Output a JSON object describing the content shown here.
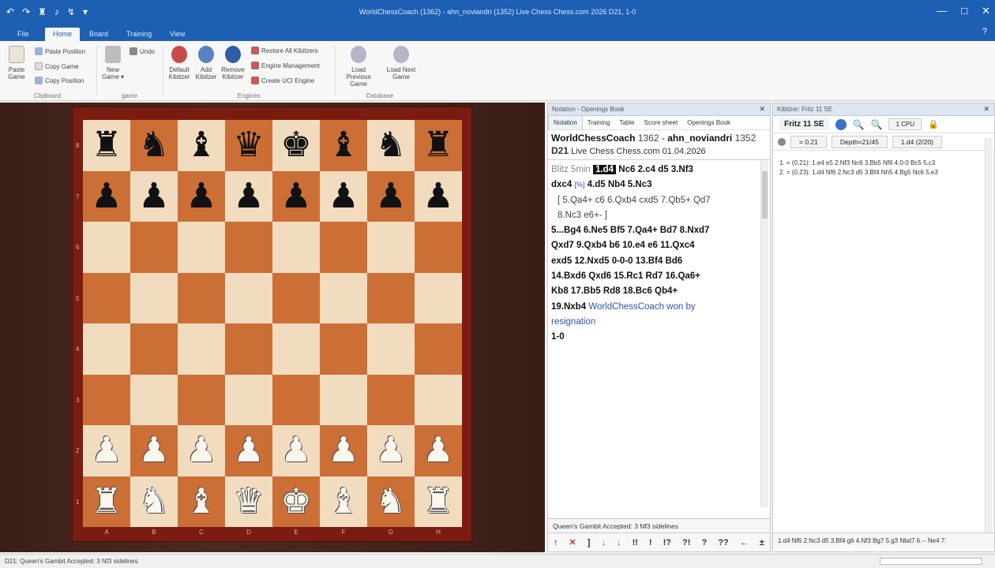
{
  "window": {
    "title": "WorldChessCoach (1362) - ahn_noviandri (1352) Live Chess Chess.com 2026  D21, 1-0",
    "controls": [
      "—",
      "□",
      "✕"
    ]
  },
  "quick_access": [
    "↶",
    "↷",
    "♜",
    "♪",
    "↯",
    "▾"
  ],
  "menu_tabs": [
    "File",
    "Home",
    "Board",
    "Training",
    "View"
  ],
  "active_tab": "Home",
  "help_icon": "?",
  "ribbon": {
    "clipboard": {
      "label": "Clipboard",
      "paste_game": "Paste Game",
      "paste_position": "Paste Position",
      "copy_game": "Copy Game",
      "copy_position": "Copy Position"
    },
    "game": {
      "label": "game",
      "new_game": "New Game ▾",
      "undo": "Undo"
    },
    "engines": {
      "label": "Engines",
      "default_kibitzer": "Default Kibitzer",
      "add_kibitzer": "Add Kibitzer",
      "remove_kibitzer": "Remove Kibitzer",
      "restore_all": "Restore All Kibitzers",
      "engine_management": "Engine Management",
      "create_uci": "Create UCI Engine"
    },
    "database": {
      "label": "Database",
      "load_previous": "Load Previous Game",
      "load_next": "Load Next Game"
    }
  },
  "board": {
    "ranks": [
      "8",
      "7",
      "6",
      "5",
      "4",
      "3",
      "2",
      "1"
    ],
    "files": [
      "A",
      "B",
      "C",
      "D",
      "E",
      "F",
      "G",
      "H"
    ],
    "position": [
      [
        "r",
        "n",
        "b",
        "q",
        "k",
        "b",
        "n",
        "r"
      ],
      [
        "p",
        "p",
        "p",
        "p",
        "p",
        "p",
        "p",
        "p"
      ],
      [
        "",
        "",
        "",
        "",
        "",
        "",
        "",
        ""
      ],
      [
        "",
        "",
        "",
        "",
        "",
        "",
        "",
        ""
      ],
      [
        "",
        "",
        "",
        "",
        "",
        "",
        "",
        ""
      ],
      [
        "",
        "",
        "",
        "",
        "",
        "",
        "",
        ""
      ],
      [
        "P",
        "P",
        "P",
        "P",
        "P",
        "P",
        "P",
        "P"
      ],
      [
        "R",
        "N",
        "B",
        "Q",
        "K",
        "B",
        "N",
        "R"
      ]
    ]
  },
  "notation": {
    "panel_title": "Notation - Openings Book",
    "close": "✕",
    "tabs": [
      "Notation",
      "Training",
      "Table",
      "Score sheet",
      "Openings Book"
    ],
    "white": "WorldChessCoach",
    "white_elo": "1362",
    "sep": "-",
    "black": "ahn_noviandri",
    "black_elo": "1352",
    "eco": "D21",
    "event": "Live Chess Chess.com 01.04.2026",
    "time_control": "Blitz 5min",
    "line1": [
      "1.d4",
      "Nc6",
      "2.c4",
      "d5",
      "3.Nf3"
    ],
    "line2": [
      "dxc4",
      "[%]",
      "4.d5",
      "Nb4",
      "5.Nc3"
    ],
    "variation1": "[ 5.Qa4+  c6  6.Qxb4  cxd5  7.Qb5+  Qd7",
    "variation2": "8.Nc3  e6+- ]",
    "line3": "5...Bg4  6.Ne5  Bf5  7.Qa4+  Bd7  8.Nxd7",
    "line4": "Qxd7  9.Qxb4  b6  10.e4  e6  11.Qxc4",
    "line5": "exd5  12.Nxd5  0-0-0  13.Bf4  Bd6",
    "line6": "14.Bxd6  Qxd6  15.Rc1  Rd7  16.Qa6+",
    "line7": "Kb8  17.Bb5  Rd8  18.Bc6  Qb4+",
    "line8_move": "19.Nxb4",
    "line8_text": "WorldChessCoach won by",
    "line9": "resignation",
    "result": "1-0",
    "opening": "Queen's Gambit Accepted: 3 Nf3 sidelines",
    "annotations": [
      "↑",
      "✕",
      "]",
      "↓",
      "↓",
      "!!",
      "!",
      "!?",
      "?!",
      "?",
      "??",
      "←",
      "±"
    ]
  },
  "engine": {
    "panel_title": "Kibitzer: Fritz 11 SE",
    "close": "✕",
    "name": "Fritz 11 SE",
    "cpu": "1 CPU",
    "eval": "= 0.21",
    "depth": "Depth=21/45",
    "current_move": "1.d4 (2/20)",
    "lines": [
      "1. = (0.21): 1.e4 e5 2.Nf3 Nc6 3.Bb5 Nf6 4.0-0 Bc5 5.c3",
      "2. = (0.23): 1.d4 Nf6 2.Nc3 d5 3.Bf4 Nh5 4.Bg5 Nc6 5.e3"
    ],
    "footer": "1.d4 Nf6 2.Nc3 d5 3.Bf4 g6 4.Nf3 Bg7 5.g3 Nbd7 6.-- Ne4 7."
  },
  "status_bar": "D21: Queen's Gambit Accepted: 3 Nf3 sidelines"
}
